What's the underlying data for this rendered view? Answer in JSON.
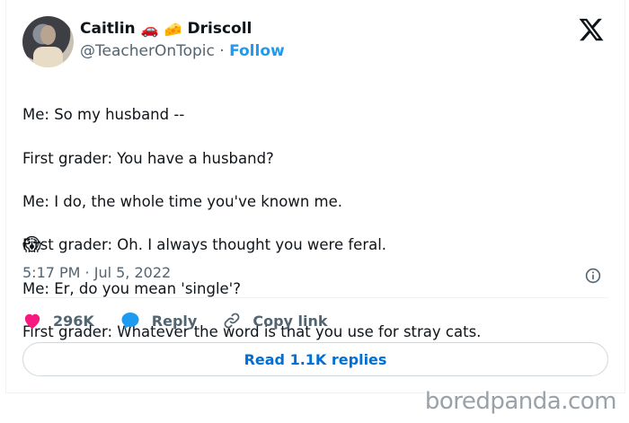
{
  "author": {
    "first_name": "Caitlin",
    "emoji_1": "🚗",
    "emoji_2": "🧀",
    "last_name": "Driscoll",
    "handle": "@TeacherOnTopic",
    "separator": "·",
    "follow_label": "Follow"
  },
  "platform_icon": "x-logo-icon",
  "tweet": {
    "lines": [
      "Me: So my husband --",
      "First grader: You have a husband?",
      "Me: I do, the whole time you've known me.",
      "First grader: Oh. I always thought you were feral.",
      "Me: Er, do you mean 'single'?",
      "First grader: Whatever the word is that you use for stray cats."
    ],
    "emoji": "😱",
    "timestamp": "5:17 PM · Jul 5, 2022"
  },
  "actions": {
    "like_count": "296K",
    "reply_label": "Reply",
    "copy_link_label": "Copy link",
    "read_replies_label": "Read 1.1K replies"
  },
  "watermark": "boredpanda.com",
  "colors": {
    "like": "#f91880",
    "reply": "#1d9bf0",
    "follow": "#1d9bf0",
    "read_replies": "#006fd6",
    "muted": "#536471"
  }
}
